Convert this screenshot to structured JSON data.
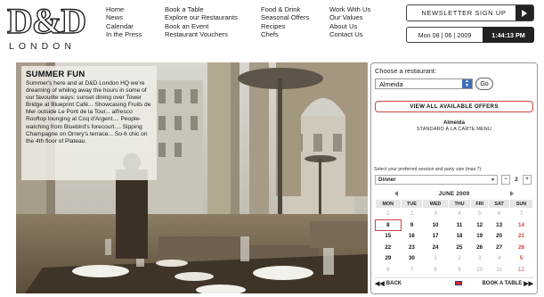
{
  "brand": {
    "mark": "D&D",
    "sub": "LONDON"
  },
  "nav": {
    "col1": [
      "Home",
      "News",
      "Calendar",
      "In the Press"
    ],
    "col2": [
      "Book a Table",
      "Explore our Restaurants",
      "Book an Event",
      "Restaurant Vouchers"
    ],
    "col3": [
      "Food & Drink",
      "Seasonal Offers",
      "Recipes",
      "Chefs"
    ],
    "col4": [
      "Work With Us",
      "Our Values",
      "About Us",
      "Contact Us"
    ]
  },
  "newsletter": {
    "label": "NEWSLETTER SIGN UP"
  },
  "datetime": {
    "date": "Mon 08 | 06 | 2009",
    "time": "1:44:13 PM"
  },
  "promo": {
    "title": "SUMMER FUN",
    "body": "Summer's here and at D&D London HQ we're dreaming of whiling away the hours in some of our favourite ways: sunset dining over Tower Bridge at Blueprint Café... Showcasing Fruits de Mer outside Le Pont de la Tour... alfresco Rooftop lounging at Coq d'Argent.... People-watching from Bluebird's forecourt.... Sipping Champagne on Orrery's terrace... So-6 chic on the 4th floor of Plateau."
  },
  "booking": {
    "choose_label": "Choose a restaurant:",
    "restaurant": "Almeida",
    "go_label": "Go",
    "offers_label": "VIEW ALL AVAILABLE OFFERS",
    "restaurant_name": "Almeida",
    "menu_label": "STANDARD À LA CARTE MENU",
    "session_prompt": "Select your preferred session and party size (max 7):",
    "session": "Dinner",
    "party_size": "2",
    "month": "JUNE 2009",
    "weekdays": [
      "MON",
      "TUE",
      "WED",
      "THU",
      "FRI",
      "SAT",
      "SUN"
    ],
    "weeks": [
      [
        "1",
        "2",
        "3",
        "4",
        "5",
        "6",
        "7"
      ],
      [
        "8",
        "9",
        "10",
        "11",
        "12",
        "13",
        "14"
      ],
      [
        "15",
        "16",
        "17",
        "18",
        "19",
        "20",
        "21"
      ],
      [
        "22",
        "23",
        "24",
        "25",
        "26",
        "27",
        "28"
      ],
      [
        "29",
        "30",
        "1",
        "2",
        "3",
        "4",
        "5"
      ],
      [
        "6",
        "7",
        "8",
        "9",
        "10",
        "11",
        "12"
      ]
    ],
    "selected_day": "8",
    "back_label": "BACK",
    "book_label": "BOOK A TABLE"
  }
}
